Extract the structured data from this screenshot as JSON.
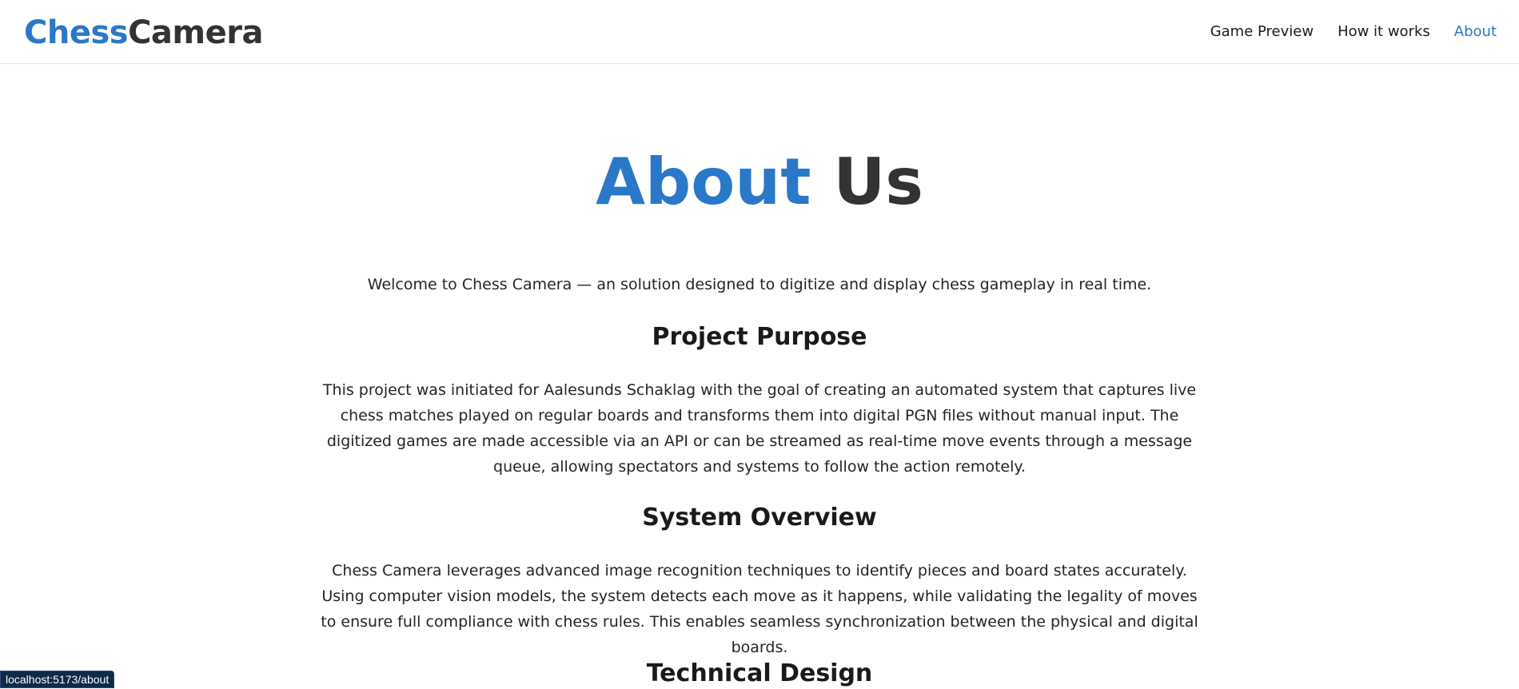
{
  "nav": {
    "brand_part1": "Chess",
    "brand_part2": "Camera",
    "links": [
      {
        "label": "Game Preview",
        "active": false
      },
      {
        "label": "How it works",
        "active": false
      },
      {
        "label": "About",
        "active": true
      }
    ]
  },
  "page": {
    "title_part1": "About",
    "title_part2": "Us",
    "intro": "Welcome to Chess Camera — an solution designed to digitize and display chess gameplay in real time.",
    "sections": [
      {
        "heading": "Project Purpose",
        "body": "This project was initiated for Aalesunds Schaklag with the goal of creating an automated system that captures live chess matches played on regular boards and transforms them into digital PGN files without manual input. The digitized games are made accessible via an API or can be streamed as real-time move events through a message queue, allowing spectators and systems to follow the action remotely."
      },
      {
        "heading": "System Overview",
        "body": "Chess Camera leverages advanced image recognition techniques to identify pieces and board states accurately. Using computer vision models, the system detects each move as it happens, while validating the legality of moves to ensure full compliance with chess rules. This enables seamless synchronization between the physical and digital boards."
      },
      {
        "heading": "Technical Design",
        "body": ""
      }
    ]
  },
  "status_bar": {
    "url": "localhost:5173/about"
  },
  "colors": {
    "accent": "#2a78c8",
    "dark": "#333333"
  }
}
